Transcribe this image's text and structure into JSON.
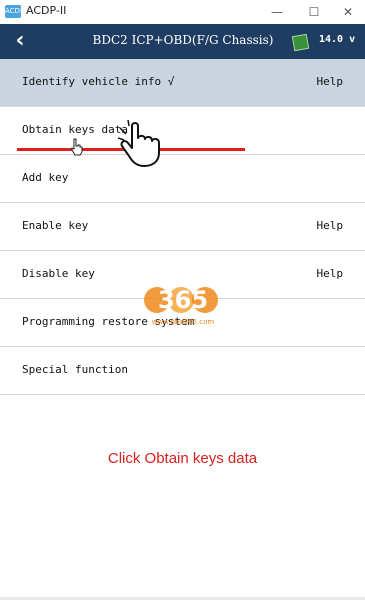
{
  "window": {
    "icon_text": "ACDP",
    "title": "ACDP-II",
    "minimize": "—",
    "maximize": "☐",
    "close": "✕"
  },
  "header": {
    "back_glyph": "‹",
    "title": "BDC2 ICP+OBD(F/G Chassis)",
    "battery_icon": "battery-icon",
    "voltage": "14.0 v"
  },
  "menu": {
    "items": [
      {
        "label": "Identify vehicle info √",
        "help": "Help",
        "selected": true
      },
      {
        "label": "Obtain keys data",
        "help": "",
        "selected": false
      },
      {
        "label": "Add key",
        "help": "",
        "selected": false
      },
      {
        "label": "Enable key",
        "help": "Help",
        "selected": false
      },
      {
        "label": "Disable key",
        "help": "Help",
        "selected": false
      },
      {
        "label": "Programming restore system",
        "help": "",
        "selected": false
      },
      {
        "label": "Special function",
        "help": "",
        "selected": false
      }
    ]
  },
  "annotation": {
    "caption": "Click Obtain keys data",
    "highlight_color": "#e01e1e"
  },
  "watermark": {
    "logo": "365",
    "url": "www.obd365.com"
  },
  "colors": {
    "header_bg": "#1f3d63",
    "selected_row_bg": "#c9d4e0",
    "caption": "#d62020"
  }
}
